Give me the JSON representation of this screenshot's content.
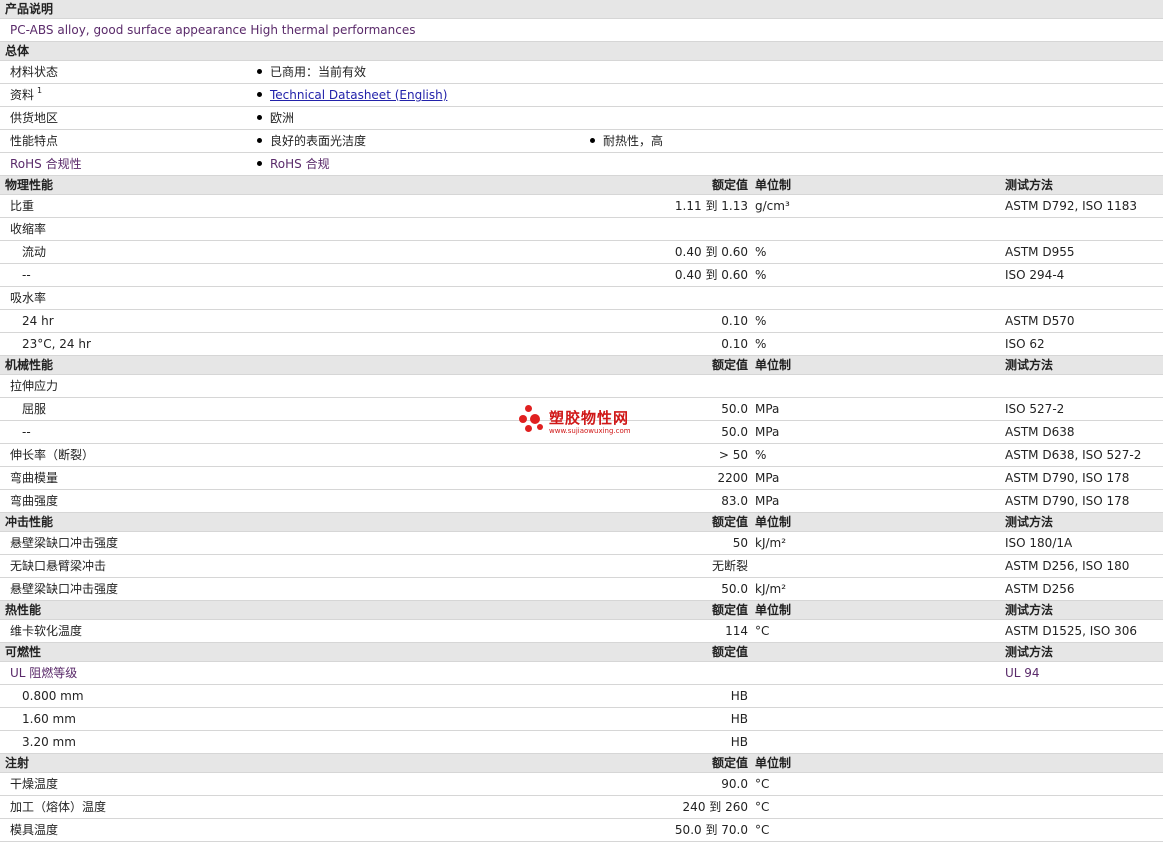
{
  "desc": {
    "title": "产品说明",
    "text": "PC-ABS alloy, good surface appearance High thermal performances"
  },
  "general": {
    "title": "总体",
    "material_label": "材料状态",
    "material_value": "已商用：当前有效",
    "docs_label": "资料",
    "docs_sup": "1",
    "docs_link": "Technical Datasheet (English)",
    "region_label": "供货地区",
    "region_value": "欧洲",
    "feature_label": "性能特点",
    "feature_v1": "良好的表面光洁度",
    "feature_v2": "耐热性，高",
    "rohs_label": "RoHS 合规性",
    "rohs_value": "RoHS 合规"
  },
  "headers": {
    "value": "额定值",
    "unit": "单位制",
    "test": "测试方法"
  },
  "physical": {
    "title": "物理性能",
    "rows": [
      {
        "label": "比重",
        "value": "1.11 到  1.13",
        "unit": "g/cm³",
        "test": "ASTM D792, ISO 1183"
      },
      {
        "label": "收缩率",
        "value": "",
        "unit": "",
        "test": ""
      },
      {
        "label": "流动",
        "value": "0.40 到  0.60",
        "unit": "%",
        "test": "ASTM D955"
      },
      {
        "label": "--",
        "value": "0.40 到  0.60",
        "unit": "%",
        "test": "ISO 294-4"
      },
      {
        "label": "吸水率",
        "value": "",
        "unit": "",
        "test": ""
      },
      {
        "label": "24 hr",
        "value": "0.10",
        "unit": "%",
        "test": "ASTM D570"
      },
      {
        "label": "23°C, 24 hr",
        "value": "0.10",
        "unit": "%",
        "test": "ISO 62"
      }
    ]
  },
  "mechanical": {
    "title": "机械性能",
    "rows": [
      {
        "label": "拉伸应力",
        "value": "",
        "unit": "",
        "test": ""
      },
      {
        "label": "屈服",
        "value": "50.0",
        "unit": "MPa",
        "test": "ISO 527-2"
      },
      {
        "label": "--",
        "value": "50.0",
        "unit": "MPa",
        "test": "ASTM D638"
      },
      {
        "label": "伸长率（断裂）",
        "value": "> 50",
        "unit": "%",
        "test": "ASTM D638, ISO 527-2"
      },
      {
        "label": "弯曲模量",
        "value": "2200",
        "unit": "MPa",
        "test": "ASTM D790, ISO 178"
      },
      {
        "label": "弯曲强度",
        "value": "83.0",
        "unit": "MPa",
        "test": "ASTM D790, ISO 178"
      }
    ]
  },
  "impact": {
    "title": "冲击性能",
    "rows": [
      {
        "label": "悬壁梁缺口冲击强度",
        "value": "50",
        "unit": "kJ/m²",
        "test": "ISO 180/1A"
      },
      {
        "label": "无缺口悬臂梁冲击",
        "value": "无断裂",
        "unit": "",
        "test": "ASTM D256, ISO 180"
      },
      {
        "label": "悬壁梁缺口冲击强度",
        "value": "50.0",
        "unit": "kJ/m²",
        "test": "ASTM D256"
      }
    ]
  },
  "thermal": {
    "title": "热性能",
    "rows": [
      {
        "label": "维卡软化温度",
        "value": "114",
        "unit": "°C",
        "test": "ASTM D1525, ISO 306"
      }
    ]
  },
  "flammability": {
    "title": "可燃性",
    "rows": [
      {
        "label": "UL 阻燃等级",
        "value": "",
        "unit": "",
        "test": "UL 94"
      },
      {
        "label": "0.800 mm",
        "value": "HB",
        "unit": "",
        "test": ""
      },
      {
        "label": "1.60 mm",
        "value": "HB",
        "unit": "",
        "test": ""
      },
      {
        "label": "3.20 mm",
        "value": "HB",
        "unit": "",
        "test": ""
      }
    ]
  },
  "injection": {
    "title": "注射",
    "rows": [
      {
        "label": "干燥温度",
        "value": "90.0",
        "unit": "°C",
        "test": ""
      },
      {
        "label": "加工（熔体）温度",
        "value": "240 到  260",
        "unit": "°C",
        "test": ""
      },
      {
        "label": "模具温度",
        "value": "50.0 到  70.0",
        "unit": "°C",
        "test": ""
      }
    ]
  },
  "watermark": {
    "name": "塑胶物性网",
    "url": "www.sujiaowuxing.com"
  }
}
